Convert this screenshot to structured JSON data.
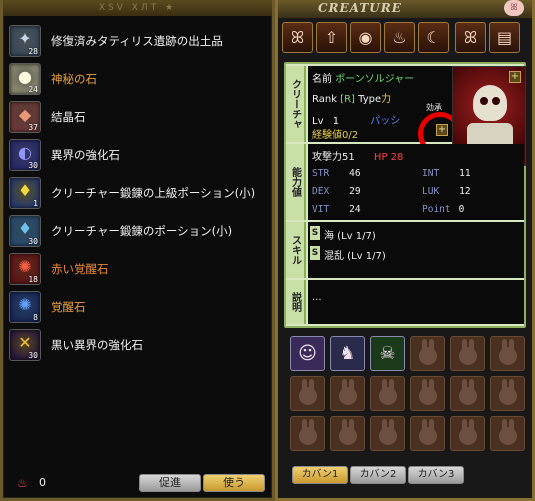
{
  "inventory": {
    "title": "XSV ХЛT ★",
    "items": [
      {
        "name": "修復済みタティリス遺跡の出土品",
        "qty": "28",
        "icon": "relic-icon",
        "color": "#3a4a5a",
        "glyph": "✦",
        "glyphColor": "#c8d8e8",
        "nameStyle": ""
      },
      {
        "name": "神秘の石",
        "qty": "24",
        "icon": "mystic-stone-icon",
        "color": "#8a8a70",
        "glyph": "●",
        "glyphColor": "#fffce0",
        "nameStyle": "orange"
      },
      {
        "name": "結晶石",
        "qty": "37",
        "icon": "crystal-stone-icon",
        "color": "#6a3a3a",
        "glyph": "◆",
        "glyphColor": "#e89878",
        "nameStyle": ""
      },
      {
        "name": "異界の強化石",
        "qty": "30",
        "icon": "otherworld-stone-icon",
        "color": "#2a2a6a",
        "glyph": "◐",
        "glyphColor": "#9098ff",
        "nameStyle": ""
      },
      {
        "name": "クリーチャー鍛錬の上級ポーション(小)",
        "qty": "1",
        "icon": "advanced-potion-icon",
        "color": "#2a3a6a",
        "glyph": "♦",
        "glyphColor": "#f0d840",
        "nameStyle": ""
      },
      {
        "name": "クリーチャー鍛錬のポーション(小)",
        "qty": "30",
        "icon": "training-potion-icon",
        "color": "#2a4a6a",
        "glyph": "♦",
        "glyphColor": "#70c0f0",
        "nameStyle": ""
      },
      {
        "name": "赤い覚醒石",
        "qty": "18",
        "icon": "red-awaken-stone-icon",
        "color": "#5a1818",
        "glyph": "✺",
        "glyphColor": "#ff6040",
        "nameStyle": "red"
      },
      {
        "name": "覚醒石",
        "qty": "8",
        "icon": "awaken-stone-icon",
        "color": "#1a2a5a",
        "glyph": "✺",
        "glyphColor": "#60a0ff",
        "nameStyle": "orange"
      },
      {
        "name": "黒い異界の強化石",
        "qty": "30",
        "icon": "dark-otherworld-stone-icon",
        "color": "#2a1a3a",
        "glyph": "✕",
        "glyphColor": "#f0c040",
        "nameStyle": ""
      }
    ],
    "money": "0",
    "promote_label": "促進",
    "use_label": "使う"
  },
  "creature": {
    "title": "CREATURE",
    "toolbar": [
      {
        "icon": "pig-icon",
        "glyph": "ꕤ"
      },
      {
        "icon": "level-up-icon",
        "glyph": "⇧"
      },
      {
        "icon": "vortex-icon",
        "glyph": "◉"
      },
      {
        "icon": "fire-icon",
        "glyph": "♨"
      },
      {
        "icon": "spirit-icon",
        "glyph": "☾"
      },
      {
        "icon": "skin-icon",
        "glyph": "ꕤ"
      },
      {
        "icon": "book-icon",
        "glyph": "▤"
      }
    ],
    "tabs": {
      "basic": "クリーチャ",
      "stats": "能力値",
      "skills": "スキル",
      "desc": "説明"
    },
    "basic": {
      "name_label": "名前",
      "name_value": "ボーンソルジャー",
      "rank_label": "Rank",
      "rank_value": "[R]",
      "type_label": "Type",
      "type_value": "力",
      "lv_label": "Lv",
      "lv_value": "1",
      "passive_label": "パッシ",
      "exp_label": "経験値",
      "exp_value": "0/2",
      "vitality_label": "効承"
    },
    "stats": {
      "atk_label": "攻撃力",
      "atk_value": "51",
      "hp_label": "HP",
      "hp_value": "28",
      "str": "46",
      "int": "11",
      "dex": "29",
      "luk": "12",
      "vit": "24",
      "point": "0"
    },
    "skills": [
      {
        "name": "海 (Lv 1/7)"
      },
      {
        "name": "混乱 (Lv 1/7)"
      }
    ],
    "description": "...",
    "slots": [
      {
        "filled": true,
        "icon": "angel-creature-icon",
        "glyph": "☺",
        "bg": "#3a2a5a"
      },
      {
        "filled": true,
        "icon": "dark-knight-creature-icon",
        "glyph": "♞",
        "bg": "#2a2a4a"
      },
      {
        "filled": true,
        "icon": "bone-soldier-creature-icon",
        "glyph": "☠",
        "bg": "#1a3a1a"
      },
      {
        "filled": false
      },
      {
        "filled": false
      },
      {
        "filled": false
      },
      {
        "filled": false
      },
      {
        "filled": false
      },
      {
        "filled": false
      },
      {
        "filled": false
      },
      {
        "filled": false
      },
      {
        "filled": false
      },
      {
        "filled": false
      },
      {
        "filled": false
      },
      {
        "filled": false
      },
      {
        "filled": false
      },
      {
        "filled": false
      },
      {
        "filled": false
      }
    ],
    "bag_tabs": [
      "カバン1",
      "カバン2",
      "カバン3"
    ],
    "active_bag": 0
  }
}
